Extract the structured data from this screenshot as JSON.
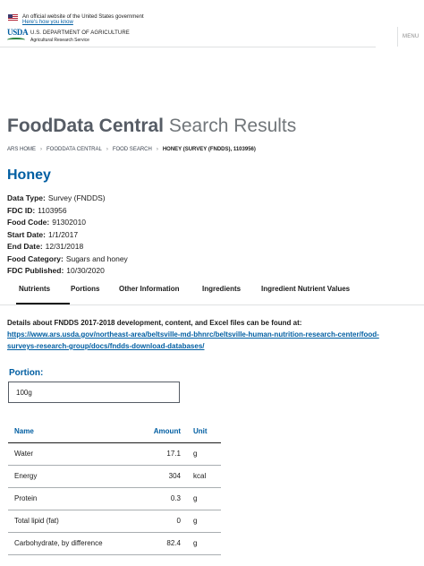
{
  "gov_banner": {
    "official_text": "An official website of the United States government",
    "how_you_know": "Here's how you know"
  },
  "header": {
    "logo_text": "USDA",
    "department": "U.S. DEPARTMENT OF AGRICULTURE",
    "agency": "Agricultural Research Service",
    "menu_label": "MENU"
  },
  "page_title": {
    "strong": "FoodData Central",
    "light": "Search Results"
  },
  "breadcrumb": {
    "items": [
      "ARS HOME",
      "FOODDATA CENTRAL",
      "FOOD SEARCH"
    ],
    "current": "HONEY (SURVEY (FNDDS), 1103956)"
  },
  "food": {
    "name": "Honey",
    "meta": [
      {
        "label": "Data Type:",
        "value": "Survey (FNDDS)"
      },
      {
        "label": "FDC ID:",
        "value": "1103956"
      },
      {
        "label": "Food Code:",
        "value": "91302010"
      },
      {
        "label": "Start Date:",
        "value": "1/1/2017"
      },
      {
        "label": "End Date:",
        "value": "12/31/2018"
      },
      {
        "label": "Food Category:",
        "value": "Sugars and honey"
      },
      {
        "label": "FDC Published:",
        "value": "10/30/2020"
      }
    ]
  },
  "tabs": [
    "Nutrients",
    "Portions",
    "Other Information",
    "Ingredients",
    "Ingredient Nutrient Values"
  ],
  "active_tab": "Nutrients",
  "details": {
    "text": "Details about FNDDS 2017-2018 development, content, and Excel files can be found at:",
    "link_line1": "https://www.ars.usda.gov/northeast-area/beltsville-md-bhnrc/beltsville-human-nutrition-research-center/food-",
    "link_line2": "surveys-research-group/docs/fndds-download-databases/"
  },
  "portion": {
    "label": "Portion:",
    "selected": "100g"
  },
  "nutrients": {
    "headers": {
      "name": "Name",
      "amount": "Amount",
      "unit": "Unit"
    },
    "rows": [
      {
        "name": "Water",
        "amount": "17.1",
        "unit": "g"
      },
      {
        "name": "Energy",
        "amount": "304",
        "unit": "kcal"
      },
      {
        "name": "Protein",
        "amount": "0.3",
        "unit": "g"
      },
      {
        "name": "Total lipid (fat)",
        "amount": "0",
        "unit": "g"
      },
      {
        "name": "Carbohydrate, by difference",
        "amount": "82.4",
        "unit": "g"
      }
    ]
  },
  "colors": {
    "accent_blue": "#005ea2",
    "title_gray": "#565c65",
    "flag_red": "#b22234",
    "flag_blue": "#3c3b6e",
    "usda_green": "#2e8540"
  }
}
